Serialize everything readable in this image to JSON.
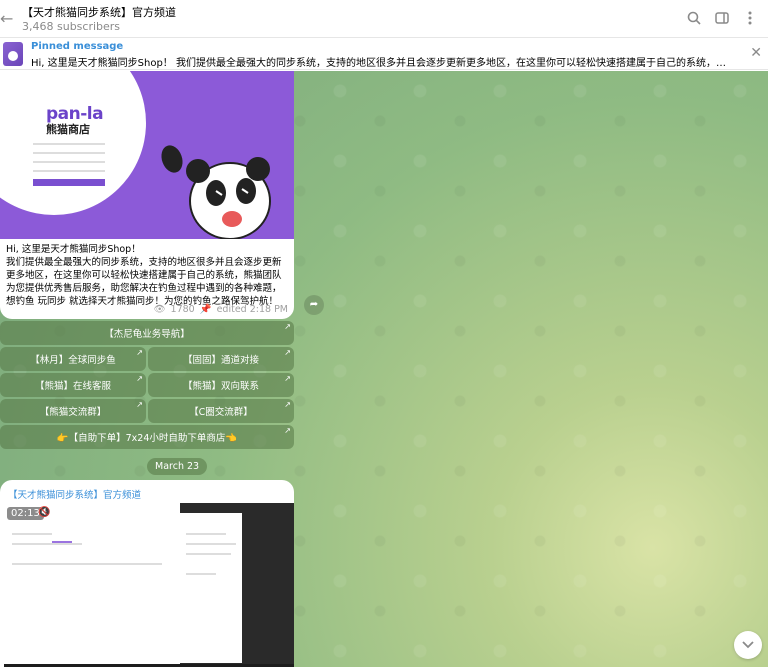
{
  "header": {
    "title": "【天才熊猫同步系统】官方频道",
    "subscribers": "3,468 subscribers"
  },
  "pinned": {
    "label": "Pinned message",
    "text": "Hi, 这里是天才熊猫同步Shop！ 我们提供最全最强大的同步系统，支持的地区很多并且会逐步更新更多地区，在这里你可以轻松快速搭建属于自己的系统，熊猫团队为您提供优..."
  },
  "banner": {
    "logo": "pan-la",
    "logo_sub": "熊猫商店"
  },
  "message": {
    "text": "Hi, 这里是天才熊猫同步Shop！\n我们提供最全最强大的同步系统，支持的地区很多并且会逐步更新更多地区，在这里你可以轻松快速搭建属于自己的系统，熊猫团队为您提供优秀售后服务，助您解决在钓鱼过程中遇到的各种难题，想钓鱼 玩同步 就选择天才熊猫同步！为您的钓鱼之路保驾护航！",
    "views": "1780",
    "edited": "edited 2:18 PM"
  },
  "keyboard": [
    [
      "【杰尼龟业务导航】"
    ],
    [
      "【林月】全球同步鱼",
      "【固固】通道对接"
    ],
    [
      "【熊猫】在线客服",
      "【熊猫】双向联系"
    ],
    [
      "【熊猫交流群】",
      "【C圈交流群】"
    ],
    [
      "👉【自助下单】7x24小时自助下单商店👈"
    ]
  ],
  "date_separator": "March 23",
  "message2": {
    "author": "【天才熊猫同步系统】官方频道",
    "video_time": "02:13"
  },
  "icons": {
    "back": "back-arrow-icon",
    "search": "search-icon",
    "sidebar": "sidebar-toggle-icon",
    "more": "more-vertical-icon",
    "close": "close-icon",
    "share": "share-icon",
    "scroll": "chevron-down-icon"
  }
}
